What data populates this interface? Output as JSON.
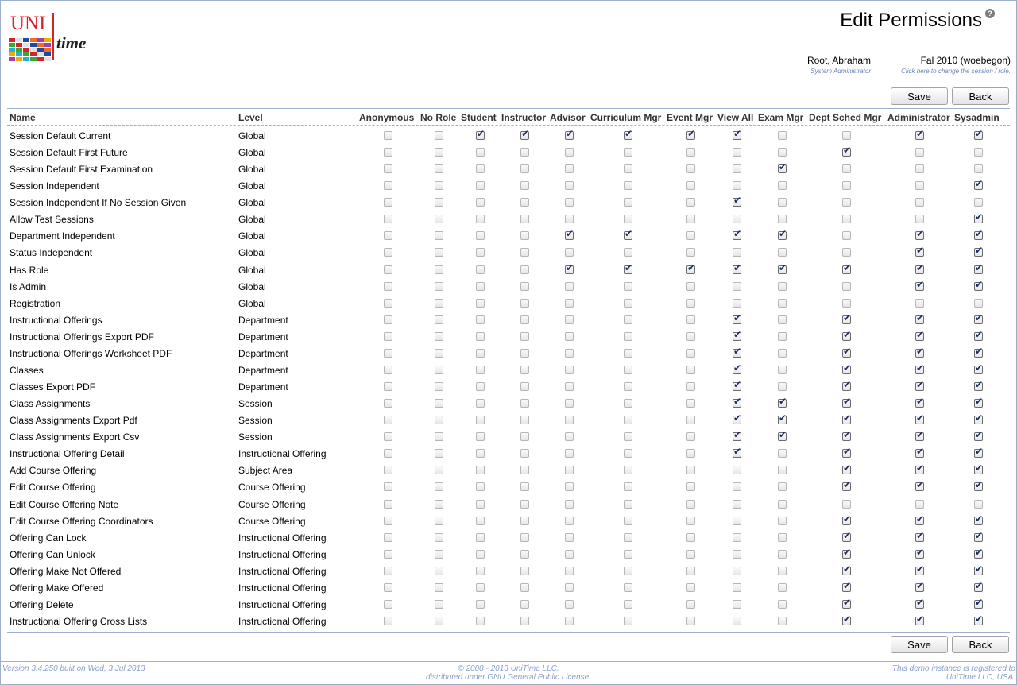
{
  "app": {
    "logo_text": "UNI",
    "logo_sub": "time",
    "page_title": "Edit Permissions",
    "help_icon": "help-icon"
  },
  "user": {
    "name": "Root, Abraham",
    "role": "System Administrator"
  },
  "session": {
    "name": "Fal 2010 (woebegon)",
    "hint": "Click here to change the session / role."
  },
  "buttons": {
    "save": "Save",
    "back": "Back"
  },
  "table": {
    "headers": [
      "Name",
      "Level",
      "Anonymous",
      "No Role",
      "Student",
      "Instructor",
      "Advisor",
      "Curriculum Mgr",
      "Event Mgr",
      "View All",
      "Exam Mgr",
      "Dept Sched Mgr",
      "Administrator",
      "Sysadmin"
    ],
    "rows": [
      {
        "name": "Session Default Current",
        "level": "Global",
        "checks": [
          0,
          0,
          1,
          1,
          1,
          1,
          1,
          1,
          0,
          0,
          1,
          1
        ]
      },
      {
        "name": "Session Default First Future",
        "level": "Global",
        "checks": [
          0,
          0,
          0,
          0,
          0,
          0,
          0,
          0,
          0,
          1,
          0,
          0
        ]
      },
      {
        "name": "Session Default First Examination",
        "level": "Global",
        "checks": [
          0,
          0,
          0,
          0,
          0,
          0,
          0,
          0,
          1,
          0,
          0,
          0
        ]
      },
      {
        "name": "Session Independent",
        "level": "Global",
        "checks": [
          0,
          0,
          0,
          0,
          0,
          0,
          0,
          0,
          0,
          0,
          0,
          1
        ]
      },
      {
        "name": "Session Independent If No Session Given",
        "level": "Global",
        "checks": [
          0,
          0,
          0,
          0,
          0,
          0,
          0,
          1,
          0,
          0,
          0,
          0
        ]
      },
      {
        "name": "Allow Test Sessions",
        "level": "Global",
        "checks": [
          0,
          0,
          0,
          0,
          0,
          0,
          0,
          0,
          0,
          0,
          0,
          1
        ]
      },
      {
        "name": "Department Independent",
        "level": "Global",
        "checks": [
          0,
          0,
          0,
          0,
          1,
          1,
          0,
          1,
          1,
          0,
          1,
          1
        ]
      },
      {
        "name": "Status Independent",
        "level": "Global",
        "checks": [
          0,
          0,
          0,
          0,
          0,
          0,
          0,
          0,
          0,
          0,
          1,
          1
        ]
      },
      {
        "name": "Has Role",
        "level": "Global",
        "checks": [
          0,
          0,
          0,
          0,
          1,
          1,
          1,
          1,
          1,
          1,
          1,
          1
        ]
      },
      {
        "name": "Is Admin",
        "level": "Global",
        "checks": [
          0,
          0,
          0,
          0,
          0,
          0,
          0,
          0,
          0,
          0,
          1,
          1
        ]
      },
      {
        "name": "Registration",
        "level": "Global",
        "checks": [
          0,
          0,
          0,
          0,
          0,
          0,
          0,
          0,
          0,
          0,
          0,
          0
        ]
      },
      {
        "name": "Instructional Offerings",
        "level": "Department",
        "checks": [
          0,
          0,
          0,
          0,
          0,
          0,
          0,
          1,
          0,
          1,
          1,
          1
        ]
      },
      {
        "name": "Instructional Offerings Export PDF",
        "level": "Department",
        "checks": [
          0,
          0,
          0,
          0,
          0,
          0,
          0,
          1,
          0,
          1,
          1,
          1
        ]
      },
      {
        "name": "Instructional Offerings Worksheet PDF",
        "level": "Department",
        "checks": [
          0,
          0,
          0,
          0,
          0,
          0,
          0,
          1,
          0,
          1,
          1,
          1
        ]
      },
      {
        "name": "Classes",
        "level": "Department",
        "checks": [
          0,
          0,
          0,
          0,
          0,
          0,
          0,
          1,
          0,
          1,
          1,
          1
        ]
      },
      {
        "name": "Classes Export PDF",
        "level": "Department",
        "checks": [
          0,
          0,
          0,
          0,
          0,
          0,
          0,
          1,
          0,
          1,
          1,
          1
        ]
      },
      {
        "name": "Class Assignments",
        "level": "Session",
        "checks": [
          0,
          0,
          0,
          0,
          0,
          0,
          0,
          1,
          1,
          1,
          1,
          1
        ]
      },
      {
        "name": "Class Assignments Export Pdf",
        "level": "Session",
        "checks": [
          0,
          0,
          0,
          0,
          0,
          0,
          0,
          1,
          1,
          1,
          1,
          1
        ]
      },
      {
        "name": "Class Assignments Export Csv",
        "level": "Session",
        "checks": [
          0,
          0,
          0,
          0,
          0,
          0,
          0,
          1,
          1,
          1,
          1,
          1
        ]
      },
      {
        "name": "Instructional Offering Detail",
        "level": "Instructional Offering",
        "checks": [
          0,
          0,
          0,
          0,
          0,
          0,
          0,
          1,
          0,
          1,
          1,
          1
        ]
      },
      {
        "name": "Add Course Offering",
        "level": "Subject Area",
        "checks": [
          0,
          0,
          0,
          0,
          0,
          0,
          0,
          0,
          0,
          1,
          1,
          1
        ]
      },
      {
        "name": "Edit Course Offering",
        "level": "Course Offering",
        "checks": [
          0,
          0,
          0,
          0,
          0,
          0,
          0,
          0,
          0,
          1,
          1,
          1
        ]
      },
      {
        "name": "Edit Course Offering Note",
        "level": "Course Offering",
        "checks": [
          0,
          0,
          0,
          0,
          0,
          0,
          0,
          0,
          0,
          0,
          0,
          0
        ]
      },
      {
        "name": "Edit Course Offering Coordinators",
        "level": "Course Offering",
        "checks": [
          0,
          0,
          0,
          0,
          0,
          0,
          0,
          0,
          0,
          1,
          1,
          1
        ]
      },
      {
        "name": "Offering Can Lock",
        "level": "Instructional Offering",
        "checks": [
          0,
          0,
          0,
          0,
          0,
          0,
          0,
          0,
          0,
          1,
          1,
          1
        ]
      },
      {
        "name": "Offering Can Unlock",
        "level": "Instructional Offering",
        "checks": [
          0,
          0,
          0,
          0,
          0,
          0,
          0,
          0,
          0,
          1,
          1,
          1
        ]
      },
      {
        "name": "Offering Make Not Offered",
        "level": "Instructional Offering",
        "checks": [
          0,
          0,
          0,
          0,
          0,
          0,
          0,
          0,
          0,
          1,
          1,
          1
        ]
      },
      {
        "name": "Offering Make Offered",
        "level": "Instructional Offering",
        "checks": [
          0,
          0,
          0,
          0,
          0,
          0,
          0,
          0,
          0,
          1,
          1,
          1
        ]
      },
      {
        "name": "Offering Delete",
        "level": "Instructional Offering",
        "checks": [
          0,
          0,
          0,
          0,
          0,
          0,
          0,
          0,
          0,
          1,
          1,
          1
        ]
      },
      {
        "name": "Instructional Offering Cross Lists",
        "level": "Instructional Offering",
        "checks": [
          0,
          0,
          0,
          0,
          0,
          0,
          0,
          0,
          0,
          1,
          1,
          1
        ]
      }
    ]
  },
  "footer": {
    "version": "Version 3.4.250 built on Wed, 3 Jul 2013",
    "copyright_1": "© 2008 - 2013 UniTime LLC,",
    "copyright_2": "distributed under GNU General Public License.",
    "demo_1": "This demo instance is registered to",
    "demo_2": "UniTime LLC, USA."
  },
  "colors": {
    "accent": "#9cb0ce",
    "link": "#6b83b5",
    "logo_red": "#d8232a",
    "logo_blue": "#1a49a6"
  }
}
